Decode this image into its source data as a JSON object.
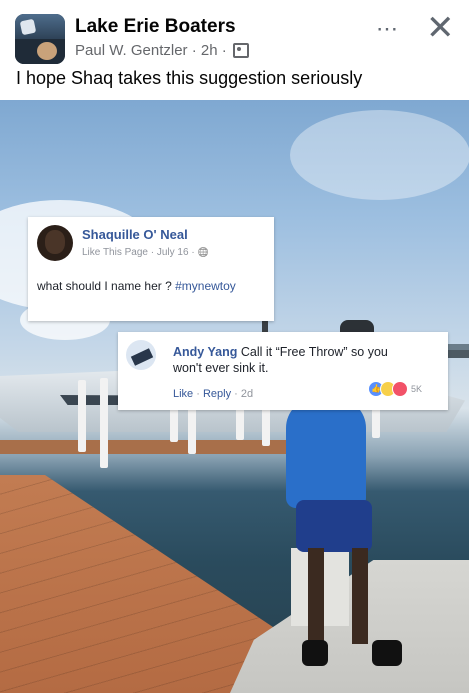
{
  "header": {
    "group_name": "Lake Erie Boaters",
    "author": "Paul W. Gentzler",
    "timestamp": "2h",
    "separator": "·",
    "more_icon": "⋯",
    "close_icon": "✕",
    "caption": "I hope Shaq takes this suggestion seriously"
  },
  "embedded_post": {
    "name": "Shaquille O' Neal",
    "sub": "Like This Page · July 16 · ",
    "globe_icon": "🌐",
    "text_prefix": "what should I name her ? ",
    "hashtag": "#mynewtoy"
  },
  "embedded_comment": {
    "name": "Andy Yang",
    "text": " Call it “Free Throw” so you won't ever sink it.",
    "like_label": "Like",
    "reply_label": "Reply",
    "dot": " · ",
    "age": "2d",
    "reaction_count": "5K"
  }
}
